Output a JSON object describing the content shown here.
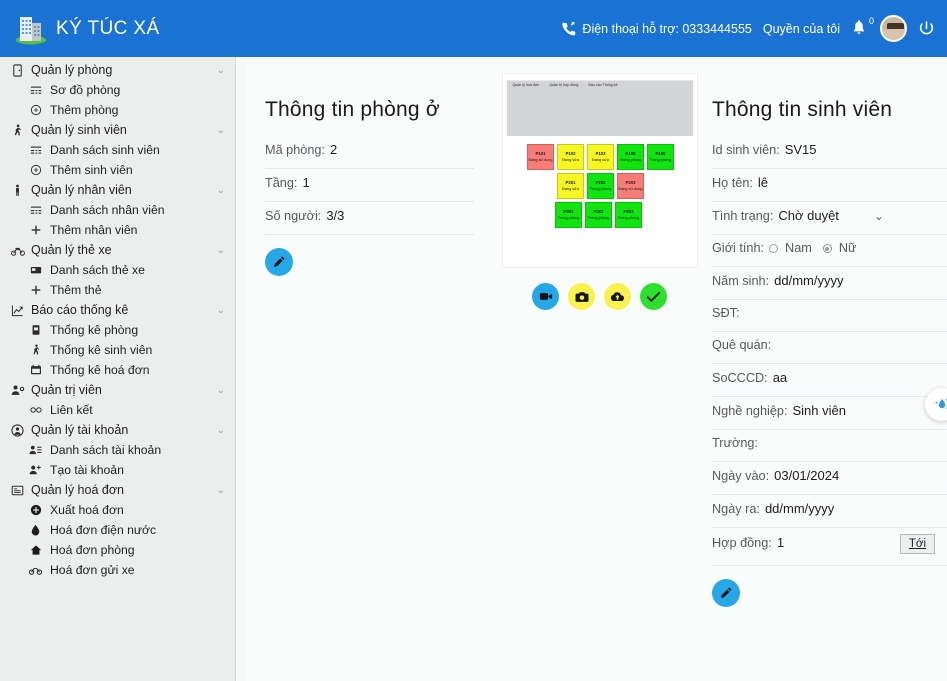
{
  "header": {
    "brand": "KÝ TÚC XÁ",
    "brand_icon": "building-icon",
    "support_label": "Điện thoại hỗ trợ: 0333444555",
    "support_icon": "phone-forward-icon",
    "my_rights_label": "Quyền của tôi",
    "bell_icon": "bell-icon",
    "bell_badge": "0",
    "avatar_icon": "user-avatar",
    "power_icon": "power-icon",
    "bg_color": "#1a73d4"
  },
  "sidebar": {
    "groups": [
      {
        "label": "Quản lý phòng",
        "icon": "door-icon",
        "chevron": "chevron-down-icon",
        "items": [
          {
            "label": "Sơ đồ phòng",
            "icon": "grid-icon"
          },
          {
            "label": "Thêm phòng",
            "icon": "plus-circle-icon"
          }
        ]
      },
      {
        "label": "Quản lý sinh viên",
        "icon": "student-walk-icon",
        "chevron": "chevron-down-icon",
        "items": [
          {
            "label": "Danh sách sinh viên",
            "icon": "grid-icon"
          },
          {
            "label": "Thêm sinh viên",
            "icon": "plus-circle-icon"
          }
        ]
      },
      {
        "label": "Quản lý nhân viên",
        "icon": "person-icon",
        "chevron": "chevron-down-icon",
        "items": [
          {
            "label": "Danh sách nhân viên",
            "icon": "grid-icon"
          },
          {
            "label": "Thêm nhân viên",
            "icon": "plus-icon"
          }
        ]
      },
      {
        "label": "Quản lý thẻ xe",
        "icon": "motorbike-icon",
        "chevron": "chevron-down-icon",
        "items": [
          {
            "label": "Danh sách thẻ xe",
            "icon": "card-icon"
          },
          {
            "label": "Thêm thẻ",
            "icon": "plus-icon"
          }
        ]
      },
      {
        "label": "Báo cáo thống kê",
        "icon": "chart-line-icon",
        "chevron": "chevron-down-icon",
        "items": [
          {
            "label": "Thống kê phòng",
            "icon": "door-stat-icon"
          },
          {
            "label": "Thống kê sinh viên",
            "icon": "student-walk-icon"
          },
          {
            "label": "Thống kê hoá đơn",
            "icon": "calendar-icon"
          }
        ]
      },
      {
        "label": "Quản trị viên",
        "icon": "admin-user-icon",
        "chevron": "chevron-down-icon",
        "items": [
          {
            "label": "Liên kết",
            "icon": "link-icon"
          }
        ]
      },
      {
        "label": "Quản lý tài khoản",
        "icon": "user-circle-icon",
        "chevron": "chevron-down-icon",
        "items": [
          {
            "label": "Danh sách tài khoản",
            "icon": "user-list-icon"
          },
          {
            "label": "Tạo tài khoản",
            "icon": "user-plus-icon"
          }
        ]
      },
      {
        "label": "Quản lý hoá đơn",
        "icon": "invoice-icon",
        "chevron": "chevron-down-icon",
        "items": [
          {
            "label": "Xuất hoá đơn",
            "icon": "plus-filled-icon"
          },
          {
            "label": "Hoá đơn điện nước",
            "icon": "water-drop-icon"
          },
          {
            "label": "Hoá đơn phòng",
            "icon": "home-icon"
          },
          {
            "label": "Hoá đơn gửi xe",
            "icon": "bike-icon"
          }
        ]
      }
    ]
  },
  "room_panel": {
    "title": "Thông tin phòng ở",
    "fields": [
      {
        "label": "Mã phòng:",
        "value": "2"
      },
      {
        "label": "Tầng:",
        "value": "1"
      },
      {
        "label": "Số người:",
        "value": "3/3"
      }
    ],
    "edit_button": {
      "icon": "pencil-icon",
      "color": "#25a7e8"
    }
  },
  "image_panel": {
    "preview_menu": [
      "Quản lý hoá đơn",
      "Quản trị hợp đồng",
      "Báo cáo  Thống kê"
    ],
    "rooms": [
      [
        {
          "code": "P101",
          "status": "Đang sử dụng",
          "color": "#f97c78"
        },
        {
          "code": "P102",
          "status": "Đang sửa",
          "color": "#f6f621"
        },
        {
          "code": "P103",
          "status": "Đang sửa",
          "color": "#f6f621"
        },
        {
          "code": "P105",
          "status": "Trống phòng",
          "color": "#10e510"
        },
        {
          "code": "P106",
          "status": "Trống phòng",
          "color": "#10e510"
        }
      ],
      [
        {
          "code": "P201",
          "status": "Đang sửa",
          "color": "#f6f621"
        },
        {
          "code": "P202",
          "status": "Trống phòng",
          "color": "#10e510"
        },
        {
          "code": "P203",
          "status": "Đang sử dụng",
          "color": "#f97c78"
        }
      ],
      [
        {
          "code": "P301",
          "status": "Trống phòng",
          "color": "#10e510"
        },
        {
          "code": "P302",
          "status": "Trống phòng",
          "color": "#10e510"
        },
        {
          "code": "P303",
          "status": "Trống phòng",
          "color": "#10e510"
        }
      ]
    ],
    "actions": [
      {
        "name": "video-button",
        "icon": "video-camera-icon",
        "color": "#25a7e8"
      },
      {
        "name": "photo-button",
        "icon": "camera-icon",
        "color": "#f7f24e"
      },
      {
        "name": "upload-button",
        "icon": "cloud-upload-icon",
        "color": "#f7f24e"
      },
      {
        "name": "confirm-button",
        "icon": "check-icon",
        "color": "#2de02d"
      }
    ]
  },
  "student_panel": {
    "title": "Thông tin sinh viên",
    "fields": [
      {
        "label": "Id sinh viên:",
        "value": "SV15"
      },
      {
        "label": "Họ tên:",
        "value": "lê"
      },
      {
        "label": "Tình trạng:",
        "value": "Chờ duyệt",
        "type": "select"
      },
      {
        "label": "Giới tính:",
        "type": "radio",
        "options": [
          "Nam",
          "Nữ"
        ],
        "selected": "Nữ"
      },
      {
        "label": "Năm sinh:",
        "value": "dd/mm/yyyy"
      },
      {
        "label": "SĐT:",
        "value": ""
      },
      {
        "label": "Quê quán:",
        "value": ""
      },
      {
        "label": "SoCCCD:",
        "value": "aa"
      },
      {
        "label": "Nghề nghiệp:",
        "value": "Sinh viên"
      },
      {
        "label": "Trường:",
        "value": ""
      },
      {
        "label": "Ngày vào:",
        "value": "03/01/2024"
      },
      {
        "label": "Ngày ra:",
        "value": "dd/mm/yyyy"
      },
      {
        "label": "Hợp đồng:",
        "value": "1",
        "action_label": "Tới"
      }
    ],
    "edit_button": {
      "icon": "pencil-icon",
      "color": "#25a7e8"
    }
  },
  "chat_widget": {
    "icon": "assistant-sparkle-icon"
  }
}
